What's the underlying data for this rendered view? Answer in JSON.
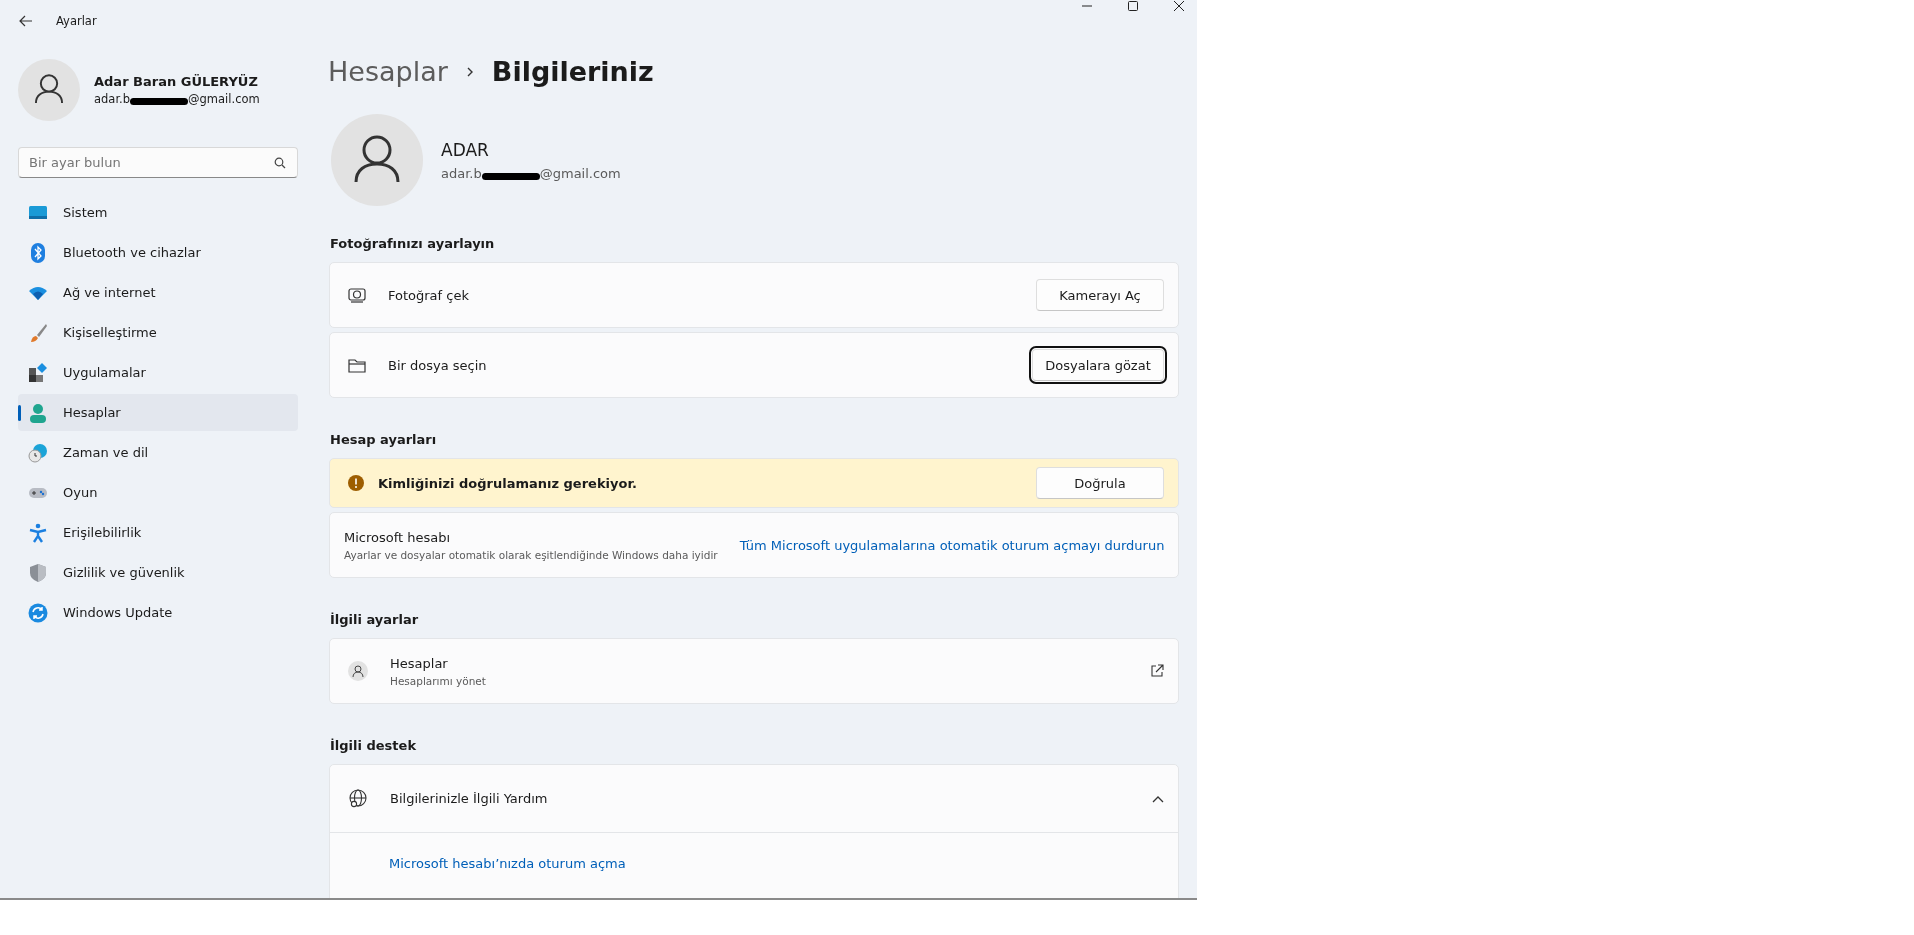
{
  "window": {
    "title": "Ayarlar"
  },
  "user": {
    "name": "Adar Baran GÜLERYÜZ",
    "email_start": "adar.b",
    "email_end": "@gmail.com"
  },
  "search": {
    "placeholder": "Bir ayar bulun"
  },
  "nav": [
    {
      "label": "Sistem",
      "selected": false
    },
    {
      "label": "Bluetooth ve cihazlar",
      "selected": false
    },
    {
      "label": "Ağ ve internet",
      "selected": false
    },
    {
      "label": "Kişiselleştirme",
      "selected": false
    },
    {
      "label": "Uygulamalar",
      "selected": false
    },
    {
      "label": "Hesaplar",
      "selected": true
    },
    {
      "label": "Zaman ve dil",
      "selected": false
    },
    {
      "label": "Oyun",
      "selected": false
    },
    {
      "label": "Erişilebilirlik",
      "selected": false
    },
    {
      "label": "Gizlilik ve güvenlik",
      "selected": false
    },
    {
      "label": "Windows Update",
      "selected": false
    }
  ],
  "breadcrumb": {
    "parent": "Hesaplar",
    "current": "Bilgileriniz"
  },
  "profile": {
    "name": "ADAR",
    "email_start": "adar.b",
    "email_end": "@gmail.com"
  },
  "photo_section": {
    "heading": "Fotoğrafınızı ayarlayın",
    "rows": [
      {
        "label": "Fotoğraf çek",
        "button": "Kamerayı Aç",
        "focused": false
      },
      {
        "label": "Bir dosya seçin",
        "button": "Dosyalara gözat",
        "focused": true
      }
    ]
  },
  "account_section": {
    "heading": "Hesap ayarları",
    "warning": {
      "text": "Kimliğinizi doğrulamanız gerekiyor.",
      "button": "Doğrula"
    },
    "microsoft_account": {
      "title": "Microsoft hesabı",
      "subtitle": "Ayarlar ve dosyalar otomatik olarak eşitlendiğinde Windows daha iyidir",
      "link": "Tüm Microsoft uygulamalarına otomatik oturum açmayı durdurun"
    }
  },
  "related_settings": {
    "heading": "İlgili ayarlar",
    "items": [
      {
        "title": "Hesaplar",
        "subtitle": "Hesaplarımı yönet"
      }
    ]
  },
  "related_support": {
    "heading": "İlgili destek",
    "expander": {
      "title": "Bilgilerinizle İlgili Yardım",
      "expanded": true,
      "links": [
        "Microsoft hesabı’nızda oturum açma"
      ]
    }
  }
}
